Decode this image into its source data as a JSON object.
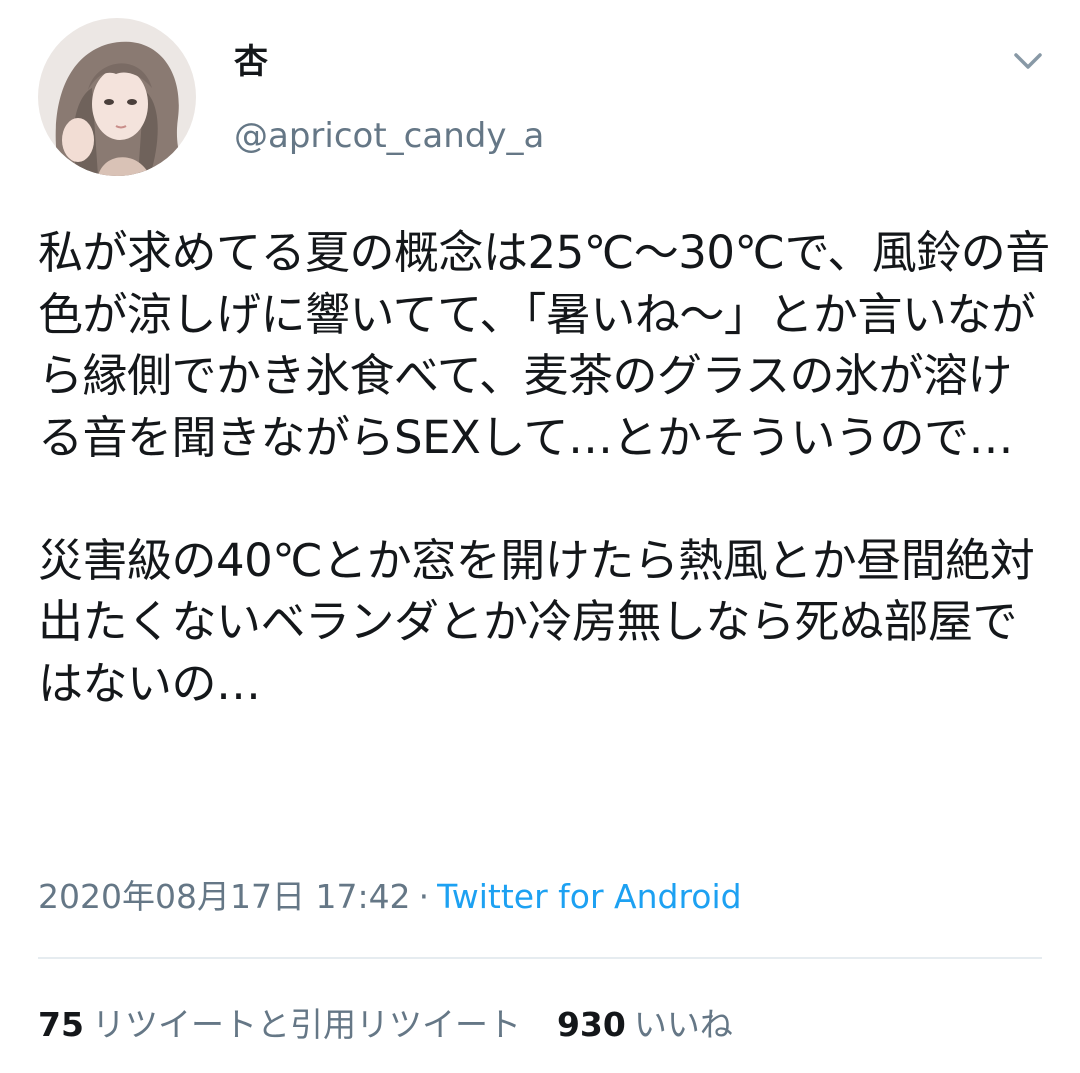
{
  "tweet": {
    "author": {
      "display_name": "杏",
      "handle": "@apricot_candy_a"
    },
    "text": "私が求めてる夏の概念は25℃〜30℃で、風鈴の音色が涼しげに響いてて、「暑いね〜」とか言いながら縁側でかき氷食べて、麦茶のグラスの氷が溶ける音を聞きながらSEXして…とかそういうので…\n\n災害級の40℃とか窓を開けたら熱風とか昼間絶対出たくないベランダとか冷房無しなら死ぬ部屋ではないの…",
    "timestamp": "2020年08月17日 17:42",
    "separator": "·",
    "source": "Twitter for Android",
    "stats": {
      "retweets_count": "75",
      "retweets_label": "リツイートと引用リツイート",
      "likes_count": "930",
      "likes_label": "いいね"
    }
  },
  "colors": {
    "text_primary": "#14171a",
    "text_secondary": "#657786",
    "link": "#1da1f2",
    "divider": "#e6ecf0"
  },
  "icons": {
    "avatar": "avatar-illustration",
    "menu": "chevron-down-icon"
  }
}
